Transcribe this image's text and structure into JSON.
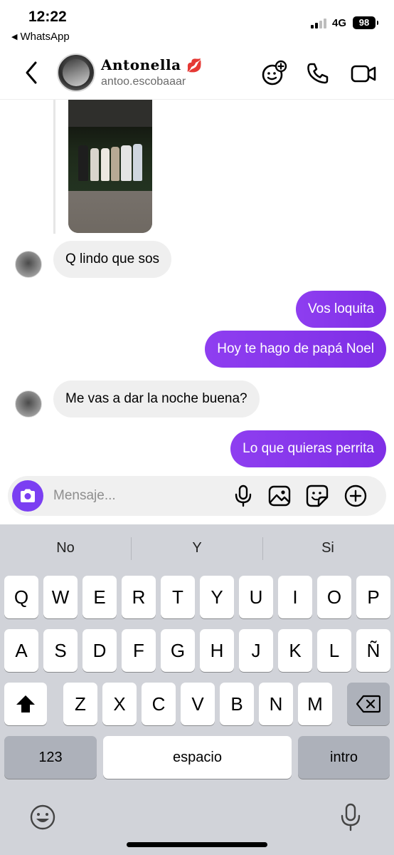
{
  "status_bar": {
    "time": "12:22",
    "back_app": "WhatsApp",
    "network": "4G",
    "battery": "98"
  },
  "header": {
    "contact_name": "Antonella",
    "contact_emoji": "💋",
    "username": "antoo.escobaaar",
    "icons": [
      "back-chevron-icon",
      "effects-icon",
      "phone-icon",
      "video-icon"
    ]
  },
  "messages": [
    {
      "dir": "in",
      "type": "photo"
    },
    {
      "dir": "in",
      "text": "Q lindo que sos"
    },
    {
      "dir": "out",
      "text": "Vos loquita"
    },
    {
      "dir": "out",
      "text": "Hoy te hago de papá Noel"
    },
    {
      "dir": "in",
      "text": "Me vas a dar la noche buena?"
    },
    {
      "dir": "out",
      "text": "Lo que quieras perrita"
    }
  ],
  "composer": {
    "placeholder": "Mensaje...",
    "icons": [
      "camera-icon",
      "microphone-icon",
      "gallery-icon",
      "sticker-icon",
      "plus-icon"
    ]
  },
  "keyboard": {
    "suggestions": [
      "No",
      "Y",
      "Si"
    ],
    "row1": [
      "Q",
      "W",
      "E",
      "R",
      "T",
      "Y",
      "U",
      "I",
      "O",
      "P"
    ],
    "row2": [
      "A",
      "S",
      "D",
      "F",
      "G",
      "H",
      "J",
      "K",
      "L",
      "Ñ"
    ],
    "row3": [
      "Z",
      "X",
      "C",
      "V",
      "B",
      "N",
      "M"
    ],
    "numbers_key": "123",
    "space_key": "espacio",
    "return_key": "intro",
    "icons": [
      "shift-icon",
      "backspace-icon",
      "emoji-icon",
      "dictation-icon"
    ]
  },
  "colors": {
    "outgoing_bubble": "#8a35ec",
    "incoming_bubble": "#efefef",
    "camera_button": "#7b3ff2",
    "keyboard_bg": "#d1d3d9"
  }
}
